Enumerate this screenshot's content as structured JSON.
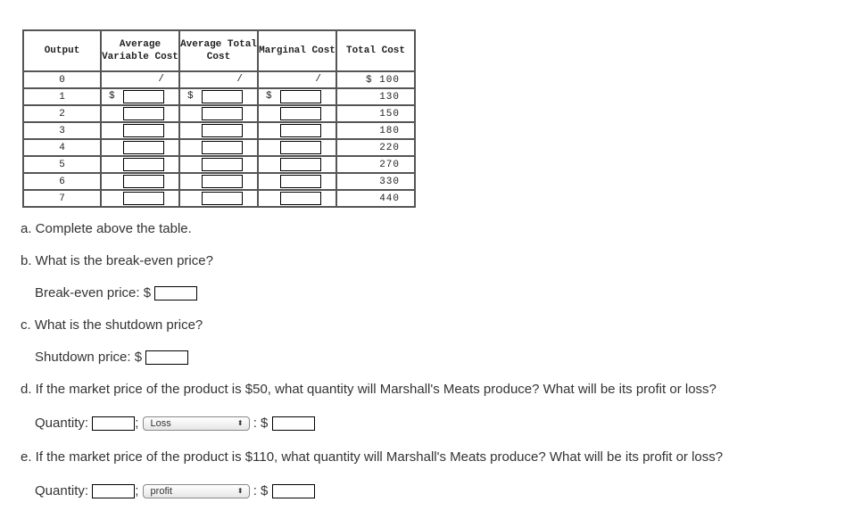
{
  "table": {
    "headers": [
      "Output",
      "Average Variable Cost",
      "Average Total Cost",
      "Marginal Cost",
      "Total Cost"
    ],
    "rows": [
      {
        "output": "0",
        "total_cost": "$ 100"
      },
      {
        "output": "1",
        "total_cost": "130"
      },
      {
        "output": "2",
        "total_cost": "150"
      },
      {
        "output": "3",
        "total_cost": "180"
      },
      {
        "output": "4",
        "total_cost": "220"
      },
      {
        "output": "5",
        "total_cost": "270"
      },
      {
        "output": "6",
        "total_cost": "330"
      },
      {
        "output": "7",
        "total_cost": "440"
      }
    ],
    "slash": "/",
    "dollar": "$"
  },
  "questions": {
    "a": "a. Complete above the table.",
    "b": "b. What is the break-even price?",
    "b_label": "Break-even price: $",
    "c": "c. What is the shutdown price?",
    "c_label": "Shutdown price: $",
    "d": "d. If the market price of the product is $50, what quantity will Marshall's Meats produce? What will be its profit or loss?",
    "e": "e. If the market price of the product is $110, what quantity will Marshall's Meats produce? What will be its profit or loss?",
    "quantity_label": "Quantity:",
    "semicolon": ";",
    "colon_dollar": ": $",
    "d_select": "Loss",
    "e_select": "profit"
  }
}
